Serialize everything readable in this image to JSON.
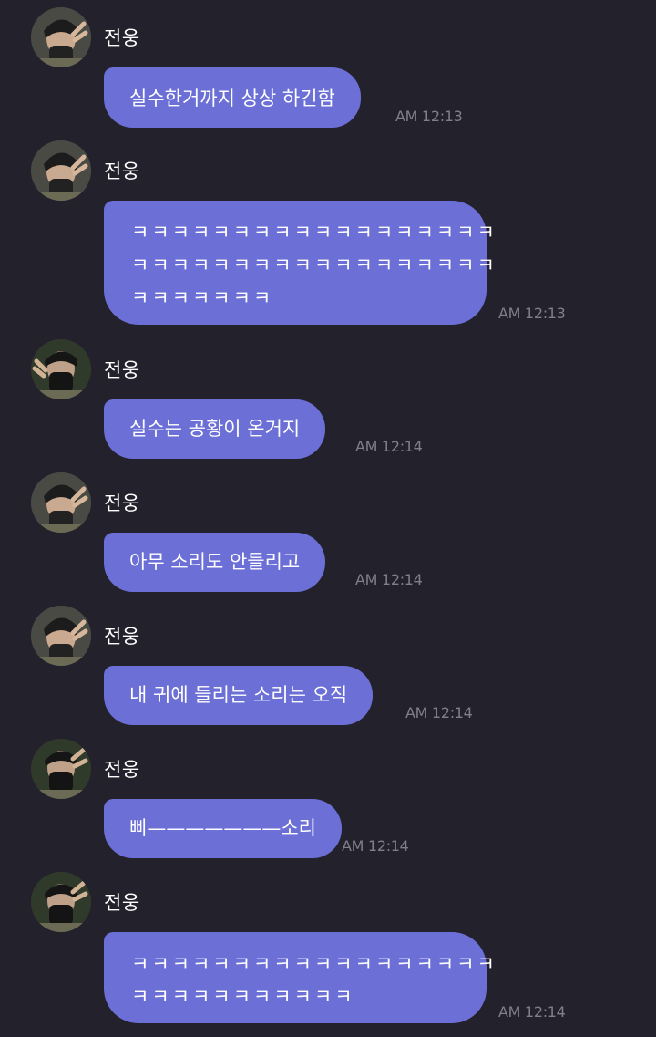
{
  "sender_name": "전웅",
  "messages": [
    {
      "sender": "전웅",
      "text": "실수한거까지 상상 하긴함",
      "time": "AM 12:13"
    },
    {
      "sender": "전웅",
      "lines": [
        "ㅋㅋㅋㅋㅋㅋㅋㅋㅋㅋㅋㅋㅋㅋㅋㅋㅋㅋ",
        "ㅋㅋㅋㅋㅋㅋㅋㅋㅋㅋㅋㅋㅋㅋㅋㅋㅋㅋ",
        "ㅋㅋㅋㅋㅋㅋㅋ"
      ],
      "time": "AM 12:13"
    },
    {
      "sender": "전웅",
      "text": "실수는 공황이 온거지",
      "time": "AM 12:14"
    },
    {
      "sender": "전웅",
      "text": "아무 소리도 안들리고",
      "time": "AM 12:14"
    },
    {
      "sender": "전웅",
      "text": "내 귀에 들리는 소리는 오직",
      "time": "AM 12:14"
    },
    {
      "sender": "전웅",
      "text": "삐———————소리",
      "time": "AM 12:14"
    },
    {
      "sender": "전웅",
      "lines": [
        "ㅋㅋㅋㅋㅋㅋㅋㅋㅋㅋㅋㅋㅋㅋㅋㅋㅋㅋ",
        "ㅋㅋㅋㅋㅋㅋㅋㅋㅋㅋㅋ"
      ],
      "time": "AM 12:14"
    }
  ],
  "colors": {
    "background": "#23222c",
    "bubble": "#6b6fd6",
    "timestamp": "#7f7e8a",
    "text": "#ffffff"
  },
  "icons": {
    "avatar": "user-photo-avatar"
  }
}
